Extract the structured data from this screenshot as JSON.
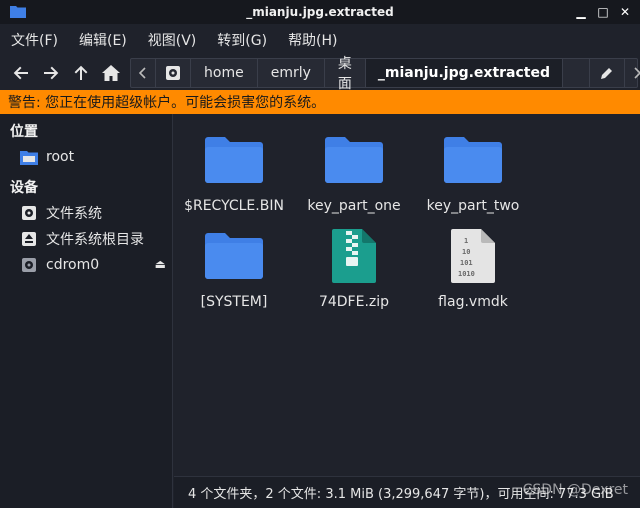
{
  "window": {
    "title": "_mianju.jpg.extracted"
  },
  "menu": [
    "文件(F)",
    "编辑(E)",
    "视图(V)",
    "转到(G)",
    "帮助(H)"
  ],
  "path": {
    "crumbs": [
      "home",
      "emrly",
      "桌面"
    ],
    "current": "_mianju.jpg.extracted"
  },
  "warning": "警告: 您正在使用超级帐户。可能会损害您的系统。",
  "sidebar": {
    "places_header": "位置",
    "places": [
      {
        "label": "root",
        "icon": "folder-icon"
      }
    ],
    "devices_header": "设备",
    "devices": [
      {
        "label": "文件系统",
        "icon": "disk-icon"
      },
      {
        "label": "文件系统根目录",
        "icon": "root-disk-icon"
      },
      {
        "label": "cdrom0",
        "icon": "cdrom-icon"
      }
    ]
  },
  "files": [
    {
      "name": "$RECYCLE.BIN",
      "type": "folder"
    },
    {
      "name": "key_part_one",
      "type": "folder"
    },
    {
      "name": "key_part_two",
      "type": "folder"
    },
    {
      "name": "[SYSTEM]",
      "type": "folder"
    },
    {
      "name": "74DFE.zip",
      "type": "zip"
    },
    {
      "name": "flag.vmdk",
      "type": "binary"
    }
  ],
  "status": "4 个文件夹，2 个文件: 3.1 MiB (3,299,647 字节)，可用空间: 77.3 GiB",
  "watermark": "CSDN @Dexret",
  "colors": {
    "folder": "#3f7fe6",
    "warning": "#ff8a00",
    "zip": "#1b9e8e"
  }
}
